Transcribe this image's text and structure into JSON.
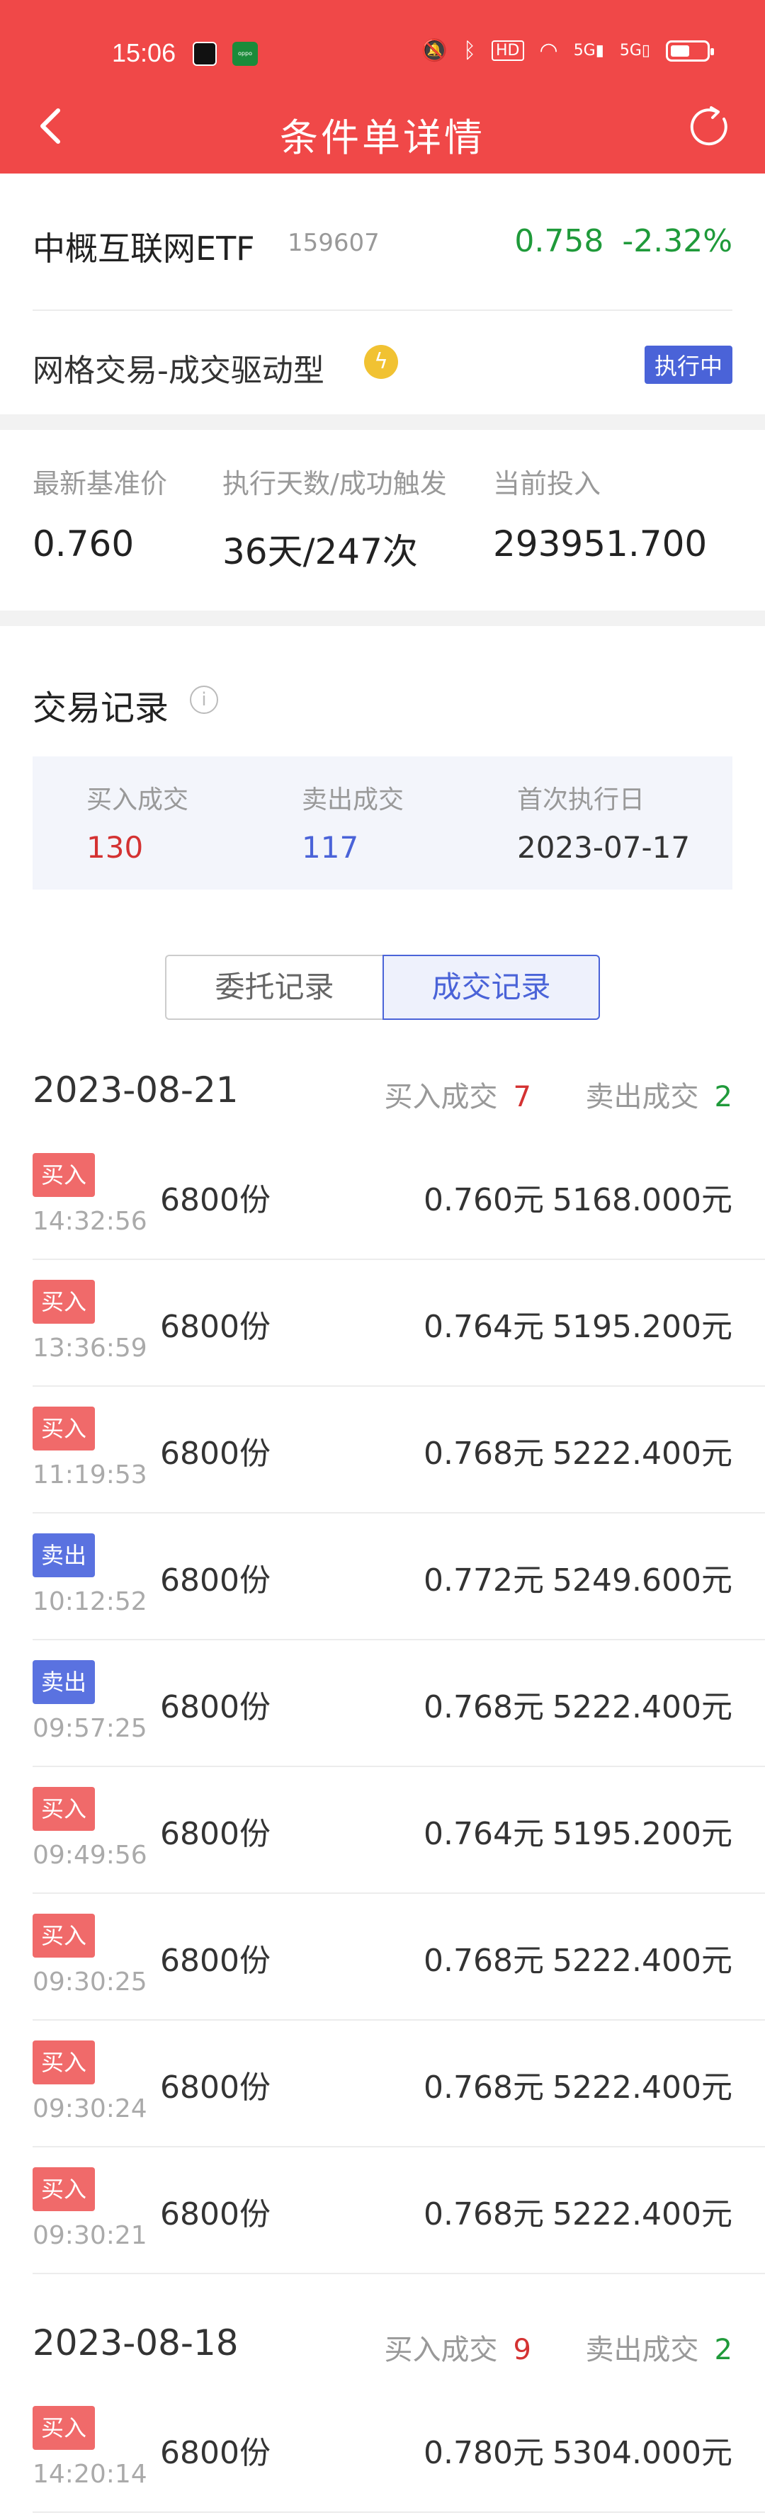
{
  "status_bar": {
    "time": "15:06",
    "icons": [
      "mute-icon",
      "bluetooth-icon",
      "hd-icon",
      "wifi-icon",
      "5g-signal-icon",
      "5g-signal-icon",
      "battery-icon"
    ]
  },
  "nav": {
    "title": "条件单详情"
  },
  "fund": {
    "name": "中概互联网ETF",
    "code": "159607",
    "price": "0.758",
    "change": "-2.32%",
    "strategy": "网格交易-成交驱动型",
    "status": "执行中"
  },
  "stats": [
    {
      "label": "最新基准价",
      "value": "0.760"
    },
    {
      "label": "执行天数/成功触发",
      "value": "36天/247次"
    },
    {
      "label": "当前投入",
      "value": "293951.700"
    }
  ],
  "records": {
    "title": "交易记录",
    "summary": {
      "buy_label": "买入成交",
      "buy_value": "130",
      "sell_label": "卖出成交",
      "sell_value": "117",
      "first_label": "首次执行日",
      "first_value": "2023-07-17"
    },
    "tabs": [
      "委托记录",
      "成交记录"
    ],
    "days": [
      {
        "date": "2023-08-21",
        "buy_label": "买入成交",
        "buy_count": "7",
        "sell_label": "卖出成交",
        "sell_count": "2",
        "rows": [
          {
            "side": "买入",
            "type": "buy",
            "time": "14:32:56",
            "qty": "6800份",
            "price": "0.760元",
            "amount": "5168.000元"
          },
          {
            "side": "买入",
            "type": "buy",
            "time": "13:36:59",
            "qty": "6800份",
            "price": "0.764元",
            "amount": "5195.200元"
          },
          {
            "side": "买入",
            "type": "buy",
            "time": "11:19:53",
            "qty": "6800份",
            "price": "0.768元",
            "amount": "5222.400元"
          },
          {
            "side": "卖出",
            "type": "sell",
            "time": "10:12:52",
            "qty": "6800份",
            "price": "0.772元",
            "amount": "5249.600元"
          },
          {
            "side": "卖出",
            "type": "sell",
            "time": "09:57:25",
            "qty": "6800份",
            "price": "0.768元",
            "amount": "5222.400元"
          },
          {
            "side": "买入",
            "type": "buy",
            "time": "09:49:56",
            "qty": "6800份",
            "price": "0.764元",
            "amount": "5195.200元"
          },
          {
            "side": "买入",
            "type": "buy",
            "time": "09:30:25",
            "qty": "6800份",
            "price": "0.768元",
            "amount": "5222.400元"
          },
          {
            "side": "买入",
            "type": "buy",
            "time": "09:30:24",
            "qty": "6800份",
            "price": "0.768元",
            "amount": "5222.400元"
          },
          {
            "side": "买入",
            "type": "buy",
            "time": "09:30:21",
            "qty": "6800份",
            "price": "0.768元",
            "amount": "5222.400元"
          }
        ]
      },
      {
        "date": "2023-08-18",
        "buy_label": "买入成交",
        "buy_count": "9",
        "sell_label": "卖出成交",
        "sell_count": "2",
        "rows": [
          {
            "side": "买入",
            "type": "buy",
            "time": "14:20:14",
            "qty": "6800份",
            "price": "0.780元",
            "amount": "5304.000元"
          }
        ]
      }
    ]
  }
}
